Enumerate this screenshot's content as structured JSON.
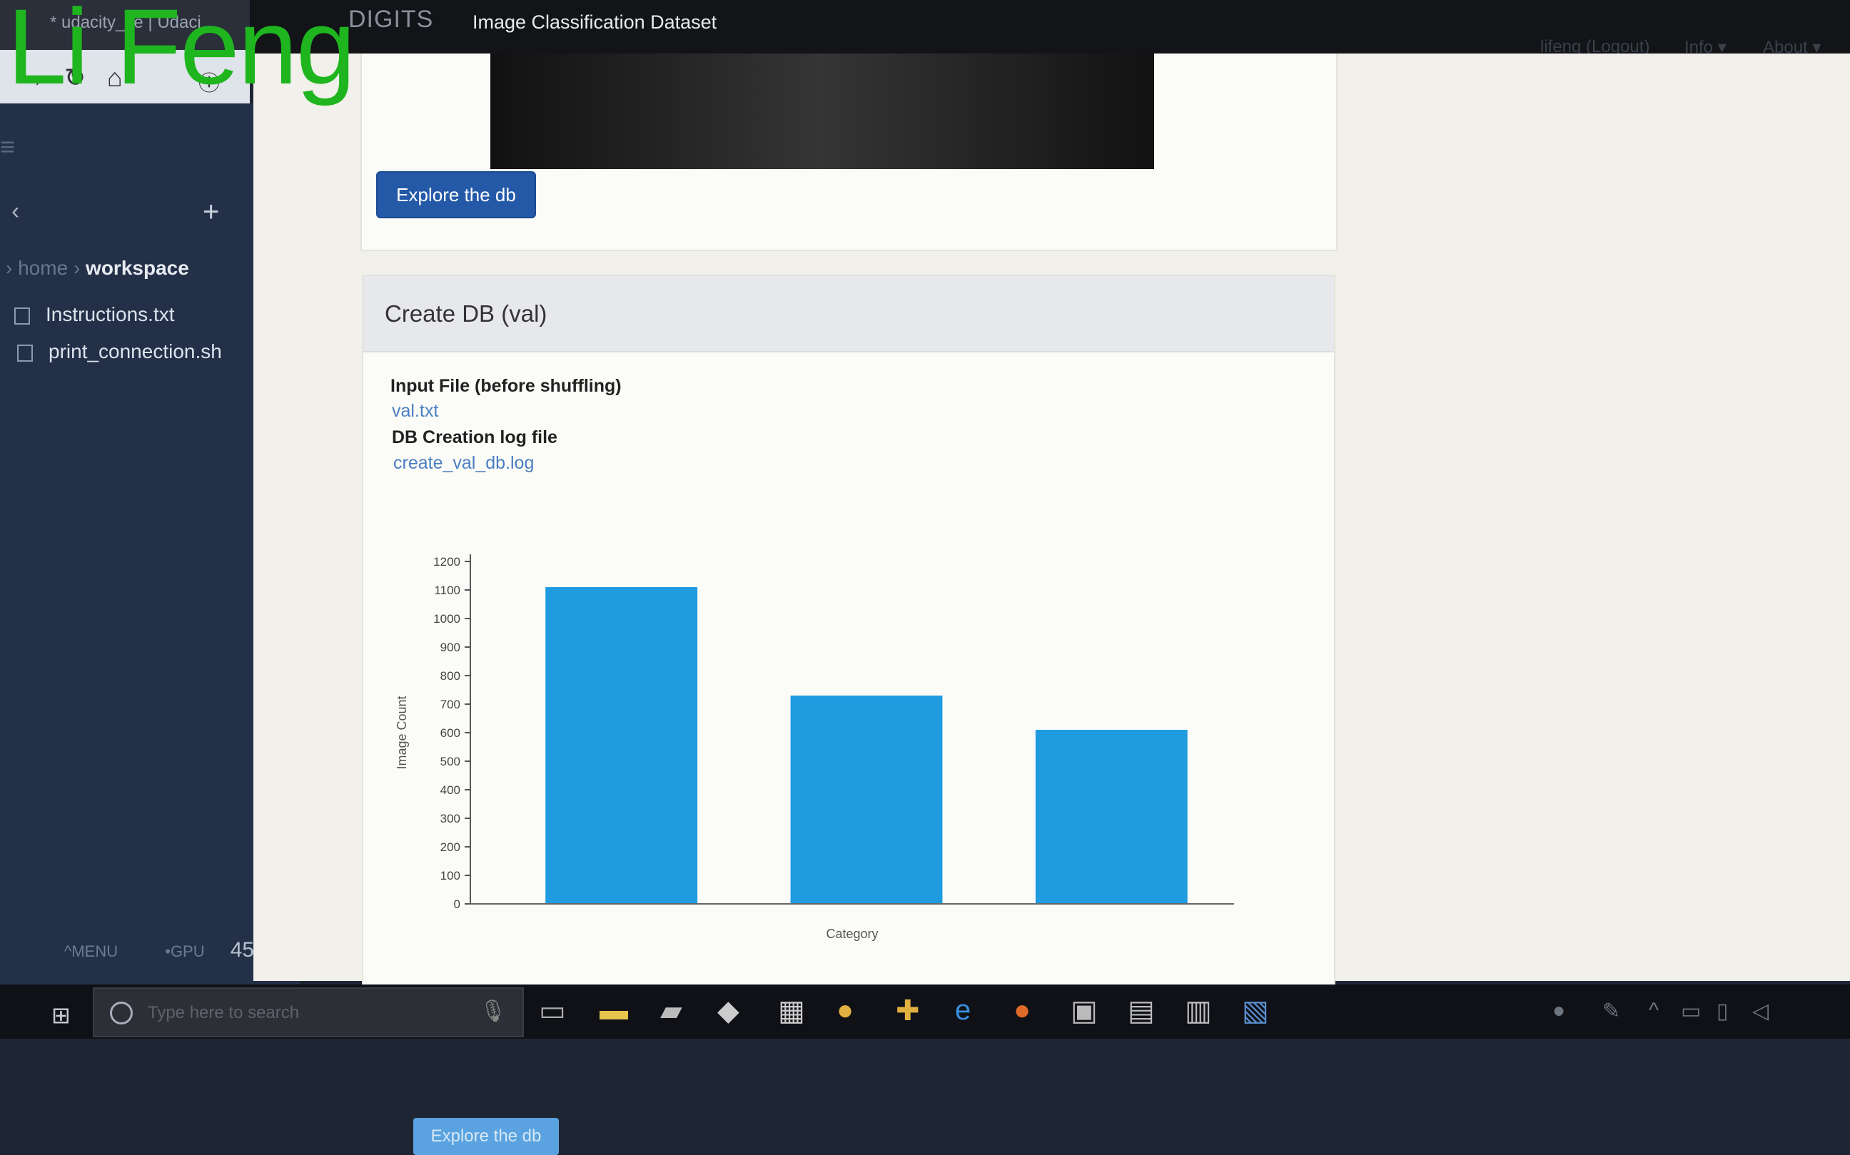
{
  "browser": {
    "tab_title": "* udacity_ce | Udaci",
    "watermark": "Li Feng"
  },
  "navbar": {
    "brand": "DIGITS",
    "title": "Image Classification Dataset",
    "user": "lifeng (Logout)",
    "info": "Info ▾",
    "about": "About ▾"
  },
  "sidebar": {
    "breadcrumb_home": "home",
    "breadcrumb_current": "workspace",
    "files": [
      "Instructions.txt",
      "print_connection.sh"
    ],
    "menu_label": "MENU",
    "gpu_label": "GPU",
    "gpu_value": "45"
  },
  "top_panel": {
    "explore_label": "Explore the db"
  },
  "panel": {
    "title": "Create DB (val)",
    "input_file_label": "Input File (before shuffling)",
    "input_file_link": "val.txt",
    "log_label": "DB Creation log file",
    "log_link": "create_val_db.log",
    "explore_label": "Explore the db"
  },
  "chart_data": {
    "type": "bar",
    "categories": [
      "",
      "",
      ""
    ],
    "values": [
      1110,
      730,
      610
    ],
    "title": "",
    "xlabel": "Category",
    "ylabel": "Image Count",
    "ylim": [
      0,
      1200
    ],
    "yticks": [
      0,
      100,
      200,
      300,
      400,
      500,
      600,
      700,
      800,
      900,
      1000,
      1100,
      1200
    ],
    "bar_color": "#1f9be0",
    "grid": false
  },
  "taskbar": {
    "search_placeholder": "Type here to search"
  }
}
